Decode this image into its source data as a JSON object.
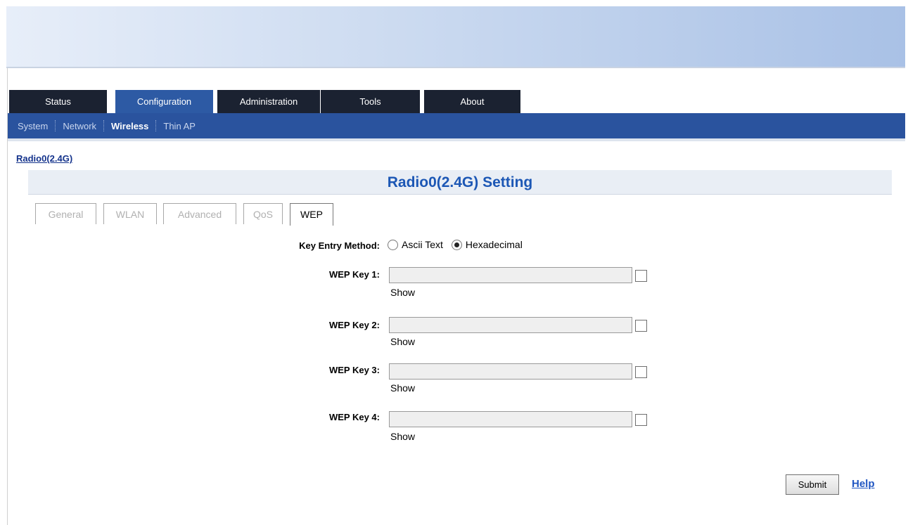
{
  "main_tabs": [
    {
      "label": "Status",
      "active": false
    },
    {
      "label": "Configuration",
      "active": true
    },
    {
      "label": "Administration",
      "active": false
    },
    {
      "label": "Tools",
      "active": false
    },
    {
      "label": "About",
      "active": false
    }
  ],
  "sub_nav": [
    {
      "label": "System",
      "active": false
    },
    {
      "label": "Network",
      "active": false
    },
    {
      "label": "Wireless",
      "active": true
    },
    {
      "label": "Thin AP",
      "active": false
    }
  ],
  "radio_link": "Radio0(2.4G)",
  "setting_title": "Radio0(2.4G) Setting",
  "sub_tabs": [
    {
      "label": "General",
      "active": false
    },
    {
      "label": "WLAN",
      "active": false
    },
    {
      "label": "Advanced",
      "active": false
    },
    {
      "label": "QoS",
      "active": false
    },
    {
      "label": "WEP",
      "active": true
    }
  ],
  "form": {
    "key_entry_label": "Key Entry Method:",
    "key_entry_options": [
      {
        "label": "Ascii Text",
        "checked": false
      },
      {
        "label": "Hexadecimal",
        "checked": true
      }
    ],
    "wep_keys": [
      {
        "label": "WEP Key 1:",
        "value": "",
        "show_label": "Show",
        "show_checked": false
      },
      {
        "label": "WEP Key 2:",
        "value": "",
        "show_label": "Show",
        "show_checked": false
      },
      {
        "label": "WEP Key 3:",
        "value": "",
        "show_label": "Show",
        "show_checked": false
      },
      {
        "label": "WEP Key 4:",
        "value": "",
        "show_label": "Show",
        "show_checked": false
      }
    ]
  },
  "actions": {
    "submit_label": "Submit",
    "help_label": "Help"
  },
  "colors": {
    "tab_dark": "#1b2231",
    "tab_active": "#2d5aa4",
    "subnav": "#2a539e",
    "title": "#1c57b5"
  }
}
